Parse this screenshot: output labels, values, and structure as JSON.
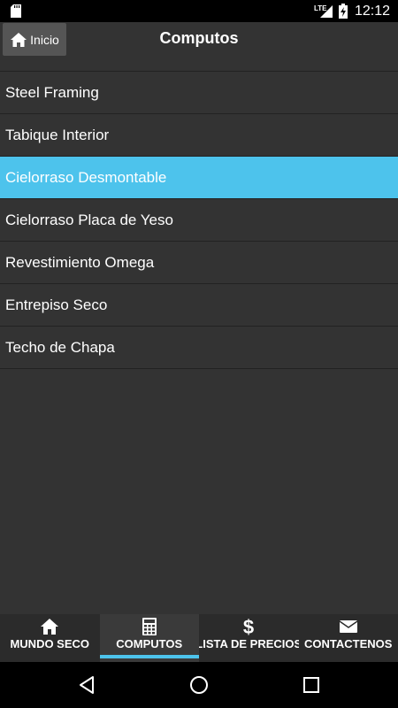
{
  "status_bar": {
    "time": "12:12",
    "network": "LTE"
  },
  "header": {
    "back_label": "Inicio",
    "title": "Computos"
  },
  "list": {
    "items": [
      {
        "label": "Steel Framing",
        "selected": false
      },
      {
        "label": "Tabique Interior",
        "selected": false
      },
      {
        "label": "Cielorraso Desmontable",
        "selected": true
      },
      {
        "label": "Cielorraso Placa de Yeso",
        "selected": false
      },
      {
        "label": "Revestimiento Omega",
        "selected": false
      },
      {
        "label": "Entrepiso Seco",
        "selected": false
      },
      {
        "label": "Techo de Chapa",
        "selected": false
      }
    ]
  },
  "tabs": [
    {
      "label": "MUNDO SECO",
      "icon": "home-icon",
      "active": false
    },
    {
      "label": "COMPUTOS",
      "icon": "calculator-icon",
      "active": true
    },
    {
      "label": "LISTA DE PRECIOS",
      "icon": "dollar-icon",
      "active": false
    },
    {
      "label": "CONTACTENOS",
      "icon": "envelope-icon",
      "active": false
    }
  ],
  "colors": {
    "background": "#333333",
    "accent": "#4dc3ec",
    "status_bar": "#000000"
  }
}
